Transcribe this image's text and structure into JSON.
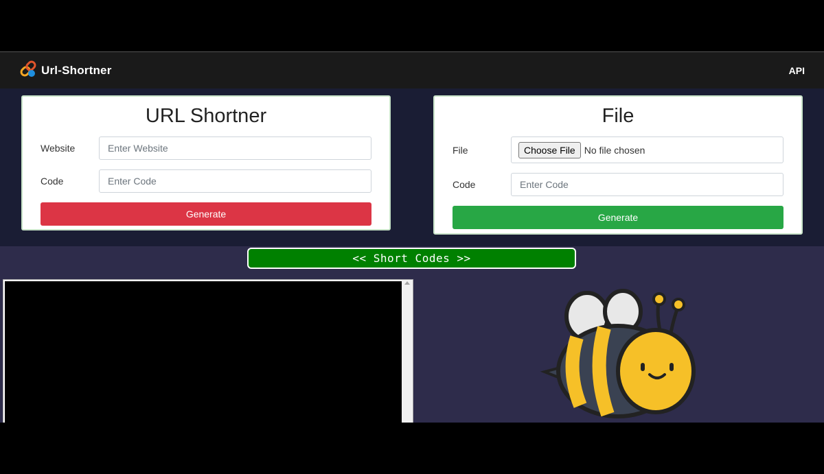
{
  "navbar": {
    "brand_title": "Url-Shortner",
    "api_link": "API",
    "logo_icon": "link-icon"
  },
  "url_form": {
    "title": "URL Shortner",
    "website_label": "Website",
    "website_placeholder": "Enter Website",
    "code_label": "Code",
    "code_placeholder": "Enter Code",
    "generate_label": "Generate",
    "button_color": "#dc3545"
  },
  "file_form": {
    "title": "File",
    "file_label": "File",
    "choose_file_label": "Choose File",
    "no_file_text": "No file chosen",
    "code_label": "Code",
    "code_placeholder": "Enter Code",
    "generate_label": "Generate",
    "button_color": "#28a745"
  },
  "short_codes": {
    "label": "<< Short Codes >>"
  },
  "mascot": {
    "icon": "bee-icon"
  }
}
